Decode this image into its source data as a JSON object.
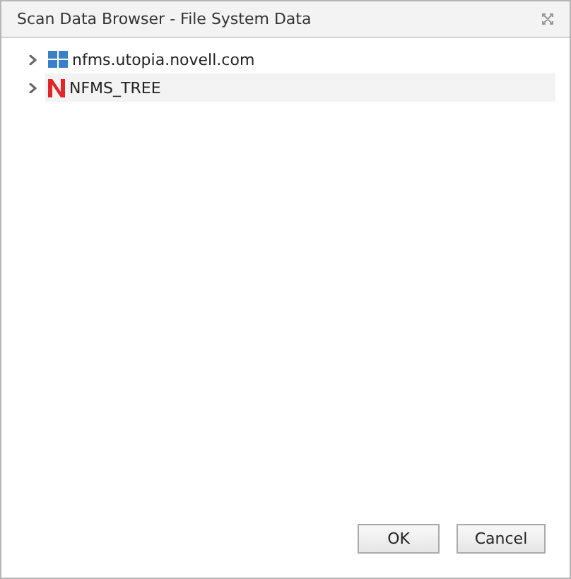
{
  "window": {
    "title": "Scan Data Browser - File System Data"
  },
  "tree": [
    {
      "label": "nfms.utopia.novell.com",
      "kind": "server",
      "expanded": false,
      "selected": false
    },
    {
      "label": "NFMS_TREE",
      "kind": "tree",
      "expanded": false,
      "selected": true
    }
  ],
  "buttons": [
    "OK",
    "Cancel"
  ]
}
